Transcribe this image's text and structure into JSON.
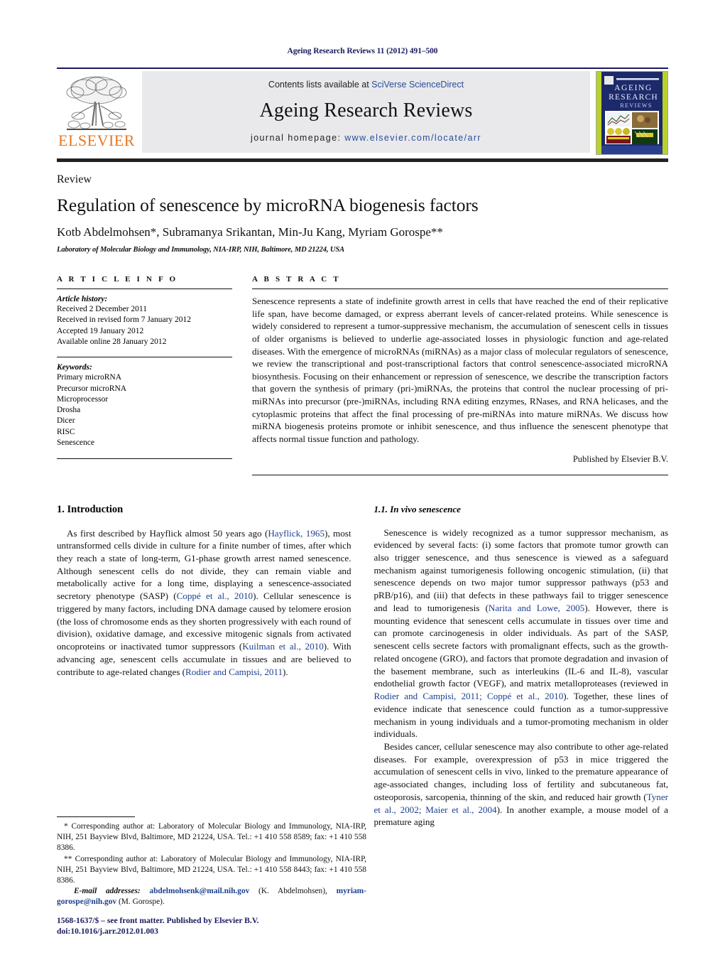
{
  "running_header": "Ageing Research Reviews 11 (2012) 491–500",
  "masthead": {
    "publisher_word": "ELSEVIER",
    "publisher_logo_icon": "elsevier-tree-icon",
    "contents_prefix": "Contents lists available at ",
    "contents_link": "SciVerse ScienceDirect",
    "journal_name": "Ageing Research Reviews",
    "homepage_prefix": "journal homepage: ",
    "homepage_url": "www.elsevier.com/locate/arr",
    "cover": {
      "line1": "AGEING",
      "line2": "RESEARCH",
      "line3": "REVIEWS",
      "bg_color": "#1c2a6b",
      "accent_color": "#b9cf2a"
    }
  },
  "title_block": {
    "doctype": "Review",
    "title": "Regulation of senescence by microRNA biogenesis factors",
    "authors": "Kotb Abdelmohsen*, Subramanya Srikantan, Min-Ju Kang, Myriam Gorospe**",
    "affiliation": "Laboratory of Molecular Biology and Immunology, NIA-IRP, NIH, Baltimore, MD 21224, USA"
  },
  "article_info": {
    "heading": "A R T I C L E   I N F O",
    "history_label": "Article history:",
    "history": [
      "Received 2 December 2011",
      "Received in revised form 7 January 2012",
      "Accepted 19 January 2012",
      "Available online 28 January 2012"
    ],
    "keywords_label": "Keywords:",
    "keywords": [
      "Primary microRNA",
      "Precursor microRNA",
      "Microprocessor",
      "Drosha",
      "Dicer",
      "RISC",
      "Senescence"
    ]
  },
  "abstract": {
    "heading": "A B S T R A C T",
    "text": "Senescence represents a state of indefinite growth arrest in cells that have reached the end of their replicative life span, have become damaged, or express aberrant levels of cancer-related proteins. While senescence is widely considered to represent a tumor-suppressive mechanism, the accumulation of senescent cells in tissues of older organisms is believed to underlie age-associated losses in physiologic function and age-related diseases. With the emergence of microRNAs (miRNAs) as a major class of molecular regulators of senescence, we review the transcriptional and post-transcriptional factors that control senescence-associated microRNA biosynthesis. Focusing on their enhancement or repression of senescence, we describe the transcription factors that govern the synthesis of primary (pri-)miRNAs, the proteins that control the nuclear processing of pri-miRNAs into precursor (pre-)miRNAs, including RNA editing enzymes, RNases, and RNA helicases, and the cytoplasmic proteins that affect the final processing of pre-miRNAs into mature miRNAs. We discuss how miRNA biogenesis proteins promote or inhibit senescence, and thus influence the senescent phenotype that affects normal tissue function and pathology.",
    "published_by": "Published by Elsevier B.V."
  },
  "body": {
    "left": {
      "section_title": "1.  Introduction",
      "paragraph_1_a": "As first described by Hayflick almost 50 years ago (",
      "paragraph_1_ref1": "Hayflick, 1965",
      "paragraph_1_b": "), most untransformed cells divide in culture for a finite number of times, after which they reach a state of long-term, G1-phase growth arrest named senescence. Although senescent cells do not divide, they can remain viable and metabolically active for a long time, displaying a senescence-associated secretory phenotype (SASP) (",
      "paragraph_1_ref2": "Coppé et al., 2010",
      "paragraph_1_c": "). Cellular senescence is triggered by many factors, including DNA damage caused by telomere erosion (the loss of chromosome ends as they shorten progressively with each round of division), oxidative damage, and excessive mitogenic signals from activated oncoproteins or inactivated tumor suppressors (",
      "paragraph_1_ref3": "Kuilman et al., 2010",
      "paragraph_1_d": "). With advancing age, senescent cells accumulate in tissues and are believed to contribute to age-related changes (",
      "paragraph_1_ref4": "Rodier and Campisi, 2011",
      "paragraph_1_e": ")."
    },
    "right": {
      "subsection_title": "1.1.  In vivo senescence",
      "paragraph_1_a": "Senescence is widely recognized as a tumor suppressor mechanism, as evidenced by several facts: (i) some factors that promote tumor growth can also trigger senescence, and thus senescence is viewed as a safeguard mechanism against tumorigenesis following oncogenic stimulation, (ii) that senescence depends on two major tumor suppressor pathways (p53 and pRB/p16), and (iii) that defects in these pathways fail to trigger senescence and lead to tumorigenesis (",
      "paragraph_1_ref1": "Narita and Lowe, 2005",
      "paragraph_1_b": "). However, there is mounting evidence that senescent cells accumulate in tissues over time and can promote carcinogenesis in older individuals. As part of the SASP, senescent cells secrete factors with promalignant effects, such as the growth-related oncogene (GRO), and factors that promote degradation and invasion of the basement membrane, such as interleukins (IL-6 and IL-8), vascular endothelial growth factor (VEGF), and matrix metalloproteases (reviewed in ",
      "paragraph_1_ref2": "Rodier and Campisi, 2011; Coppé et al., 2010",
      "paragraph_1_c": "). Together, these lines of evidence indicate that senescence could function as a tumor-suppressive mechanism in young individuals and a tumor-promoting mechanism in older individuals.",
      "paragraph_2_a": "Besides cancer, cellular senescence may also contribute to other age-related diseases. For example, overexpression of p53 in mice triggered the accumulation of senescent cells in vivo, linked to the premature appearance of age-associated changes, including loss of fertility and subcutaneous fat, osteoporosis, sarcopenia, thinning of the skin, and reduced hair growth (",
      "paragraph_2_ref1": "Tyner et al., 2002; Maier et al., 2004",
      "paragraph_2_b": "). In another example, a mouse model of a premature aging"
    }
  },
  "footnotes": {
    "note1": "* Corresponding author at: Laboratory of Molecular Biology and Immunology, NIA-IRP, NIH, 251 Bayview Blvd, Baltimore, MD 21224, USA. Tel.: +1 410 558 8589; fax: +1 410 558 8386.",
    "note2": "** Corresponding author at: Laboratory of Molecular Biology and Immunology, NIA-IRP, NIH, 251 Bayview Blvd, Baltimore, MD 21224, USA. Tel.: +1 410 558 8443; fax: +1 410 558 8386.",
    "email_label": "E-mail addresses:",
    "email1": "abdelmohsenk@mail.nih.gov",
    "email1_owner": " (K. Abdelmohsen),",
    "email2": "myriam-gorospe@nih.gov",
    "email2_owner": " (M. Gorospe)."
  },
  "colophon": {
    "line1": "1568-1637/$ – see front matter. Published by Elsevier B.V.",
    "line2": "doi:10.1016/j.arr.2012.01.003"
  }
}
